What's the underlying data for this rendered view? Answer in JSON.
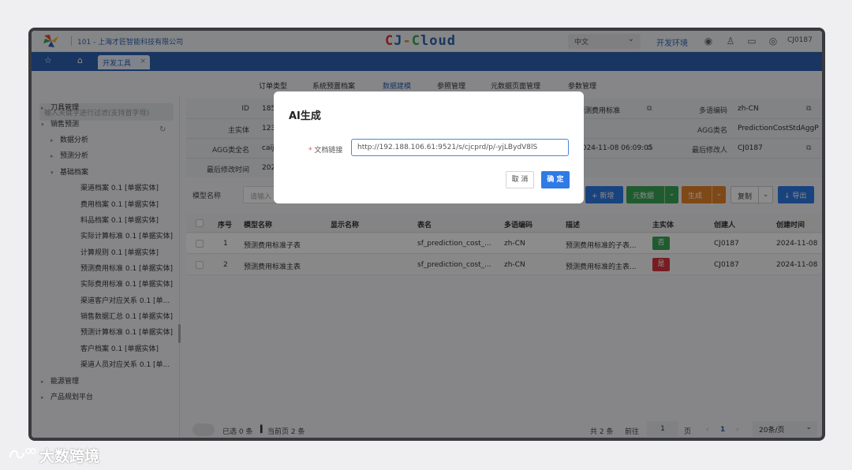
{
  "topbar": {
    "company": "101 - 上海才匠智能科技有限公司",
    "brand": "CJ-Cloud",
    "lang": "中文",
    "env": "开发环境",
    "user": "CJ0187"
  },
  "tabbar": {
    "tab_label": "开发工具"
  },
  "menubar": {
    "items": [
      "订单类型",
      "系统预置档案",
      "数据建模",
      "参照管理",
      "元数据页面管理",
      "参数管理"
    ],
    "active": "数据建模"
  },
  "sidebar": {
    "search_placeholder": "输入关键字进行过滤(支持首字母)",
    "tree": [
      {
        "label": "刀具管理",
        "level": 0,
        "arrow": "▸"
      },
      {
        "label": "销售预测",
        "level": 0,
        "arrow": "▾"
      },
      {
        "label": "数据分析",
        "level": 1,
        "arrow": "▸"
      },
      {
        "label": "预测分析",
        "level": 1,
        "arrow": "▸"
      },
      {
        "label": "基础档案",
        "level": 1,
        "arrow": "▾"
      },
      {
        "label": "渠道档案 0.1 [单据实体]",
        "level": 2,
        "arrow": ""
      },
      {
        "label": "费用档案 0.1 [单据实体]",
        "level": 2,
        "arrow": ""
      },
      {
        "label": "料品档案 0.1 [单据实体]",
        "level": 2,
        "arrow": ""
      },
      {
        "label": "实际计算标准 0.1 [单据实体]",
        "level": 2,
        "arrow": ""
      },
      {
        "label": "计算规则 0.1 [单据实体]",
        "level": 2,
        "arrow": ""
      },
      {
        "label": "预测费用标准 0.1 [单据实体]",
        "level": 2,
        "arrow": ""
      },
      {
        "label": "实际费用标准 0.1 [单据实体]",
        "level": 2,
        "arrow": ""
      },
      {
        "label": "渠道客户对应关系 0.1 [单...",
        "level": 2,
        "arrow": ""
      },
      {
        "label": "销售数据汇总 0.1 [单据实体]",
        "level": 2,
        "arrow": ""
      },
      {
        "label": "预测计算标准 0.1 [单据实体]",
        "level": 2,
        "arrow": ""
      },
      {
        "label": "客户档案 0.1 [单据实体]",
        "level": 2,
        "arrow": ""
      },
      {
        "label": "渠道人员对应关系 0.1 [单...",
        "level": 2,
        "arrow": ""
      },
      {
        "label": "能源管理",
        "level": 0,
        "arrow": "▸"
      },
      {
        "label": "产品规划平台",
        "level": 0,
        "arrow": "▸"
      }
    ]
  },
  "form": {
    "id_label": "ID",
    "id_value": "185",
    "entity_label": "主实体",
    "entity_value": "123",
    "agg_full_label": "AGG类全名",
    "agg_full_value": "caij",
    "modified_label": "最后修改时间",
    "modified_value": "202",
    "desc_value": "预测费用标准",
    "created_value": "2024-11-08 06:09:05",
    "lang_code_label": "多语编码",
    "lang_code_value": "zh-CN",
    "agg_name_label": "AGG类名",
    "agg_name_value": "PredictionCostStdAggP",
    "modifier_label": "最后修改人",
    "modifier_value": "CJ0187"
  },
  "toolbar": {
    "model_name_label": "模型名称",
    "model_name_placeholder": "请输入",
    "add": "+ 新增",
    "meta": "元数据",
    "generate": "生成",
    "copy": "复制",
    "export": "↓ 导出"
  },
  "table": {
    "headers": [
      "序号",
      "模型名称",
      "显示名称",
      "表名",
      "多语编码",
      "描述",
      "主实体",
      "创建人",
      "创建时间"
    ],
    "rows": [
      {
        "no": "1",
        "model": "预测费用标准子表",
        "display": "",
        "table": "sf_prediction_cost_...",
        "lang": "zh-CN",
        "desc": "预测费用标准的子表...",
        "main": "否",
        "creator": "CJ0187",
        "created": "2024-11-08"
      },
      {
        "no": "2",
        "model": "预测费用标准主表",
        "display": "",
        "table": "sf_prediction_cost_...",
        "lang": "zh-CN",
        "desc": "预测费用标准的主表...",
        "main": "是",
        "creator": "CJ0187",
        "created": "2024-11-08"
      }
    ]
  },
  "footer": {
    "selected": "已选 0 条",
    "current": "当前页 2 条",
    "total": "共 2 条",
    "goto": "前往",
    "page_input": "1",
    "page_unit": "页",
    "current_page": "1",
    "page_size": "20条/页"
  },
  "modal": {
    "title": "AI生成",
    "label": "文档链接",
    "required_mark": "*",
    "url": "http://192.188.106.61:9521/s/cjcprd/p/-yjLBydV8lS",
    "cancel": "取 消",
    "ok": "确 定"
  },
  "watermark": "大数跨境",
  "colors": {
    "primary": "#2f62b3",
    "green": "#3aa655",
    "orange": "#e8842a",
    "red": "#d9363e",
    "blue_btn": "#2f7ae5"
  }
}
